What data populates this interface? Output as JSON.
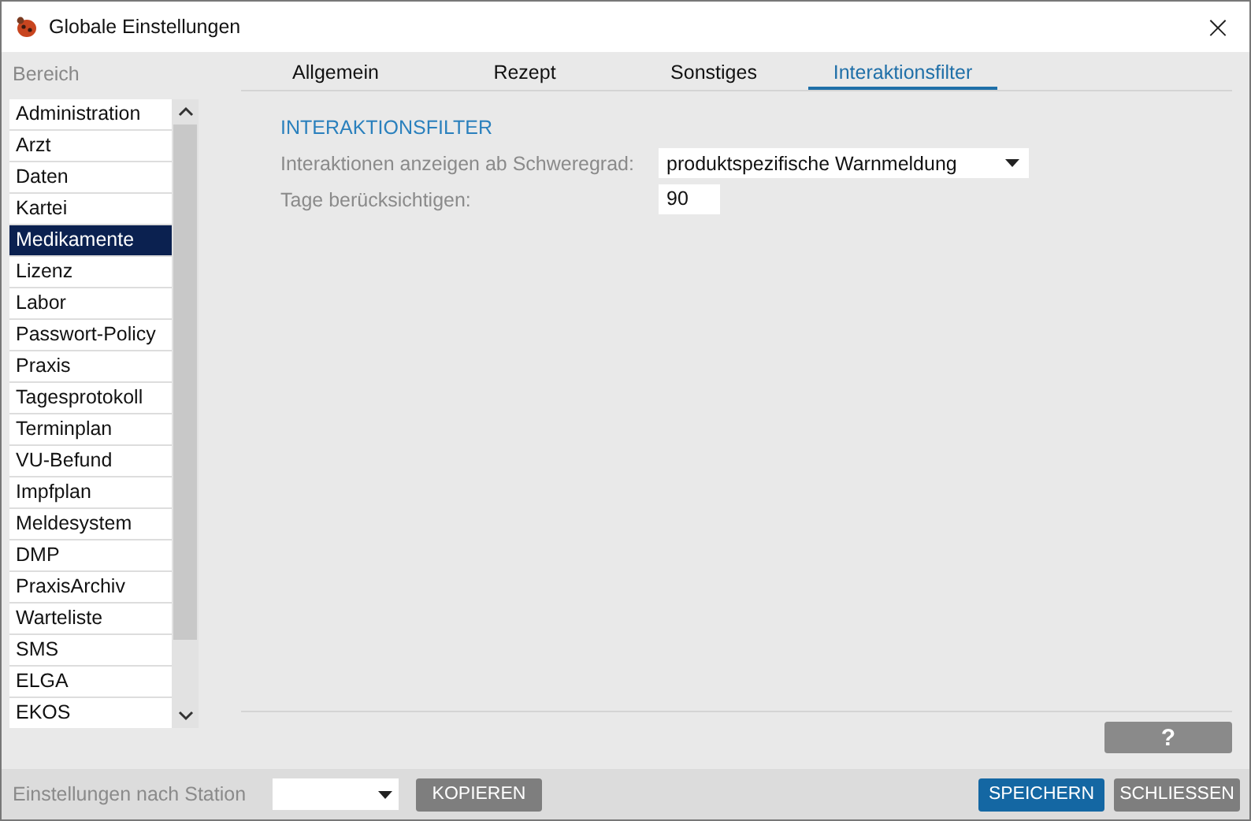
{
  "window": {
    "title": "Globale Einstellungen",
    "close": "×"
  },
  "sidebar": {
    "label": "Bereich",
    "items": [
      {
        "label": "Administration",
        "selected": false
      },
      {
        "label": "Arzt",
        "selected": false
      },
      {
        "label": "Daten",
        "selected": false
      },
      {
        "label": "Kartei",
        "selected": false
      },
      {
        "label": "Medikamente",
        "selected": true
      },
      {
        "label": "Lizenz",
        "selected": false
      },
      {
        "label": "Labor",
        "selected": false
      },
      {
        "label": "Passwort-Policy",
        "selected": false
      },
      {
        "label": "Praxis",
        "selected": false
      },
      {
        "label": "Tagesprotokoll",
        "selected": false
      },
      {
        "label": "Terminplan",
        "selected": false
      },
      {
        "label": "VU-Befund",
        "selected": false
      },
      {
        "label": "Impfplan",
        "selected": false
      },
      {
        "label": "Meldesystem",
        "selected": false
      },
      {
        "label": "DMP",
        "selected": false
      },
      {
        "label": "PraxisArchiv",
        "selected": false
      },
      {
        "label": "Warteliste",
        "selected": false
      },
      {
        "label": "SMS",
        "selected": false
      },
      {
        "label": "ELGA",
        "selected": false
      },
      {
        "label": "EKOS",
        "selected": false
      }
    ]
  },
  "tabs": [
    {
      "label": "Allgemein",
      "selected": false
    },
    {
      "label": "Rezept",
      "selected": false
    },
    {
      "label": "Sonstiges",
      "selected": false
    },
    {
      "label": "Interaktionsfilter",
      "selected": true
    }
  ],
  "section": {
    "title": "INTERAKTIONSFILTER",
    "fields": [
      {
        "kind": "dropdown",
        "label": "Interaktionen anzeigen ab Schweregrad:",
        "value": "produktspezifische Warnmeldung"
      },
      {
        "kind": "input",
        "label": "Tage berücksichtigen:",
        "value": "90"
      }
    ]
  },
  "help_button": "?",
  "footer": {
    "label": "Einstellungen nach Station",
    "copy_button": "KOPIEREN",
    "save_button": "SPEICHERN",
    "close_button": "SCHLIESSEN"
  }
}
